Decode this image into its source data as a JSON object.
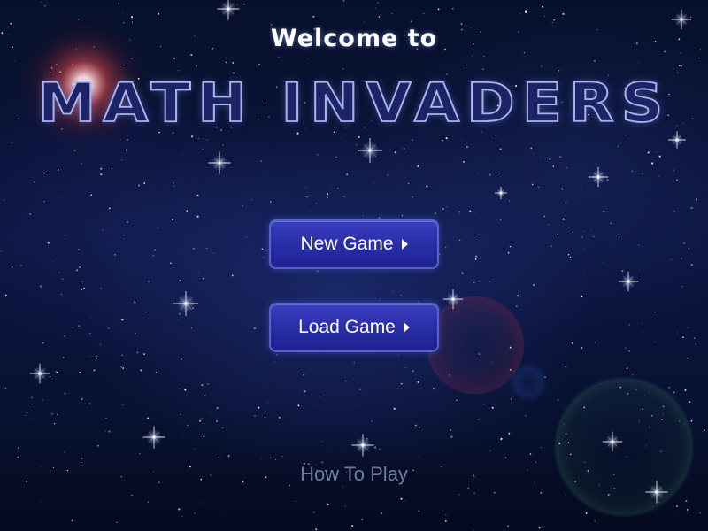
{
  "welcome_text": "Welcome to",
  "game_title": "MATH INVADERS",
  "menu": {
    "new_game_label": "New Game",
    "load_game_label": "Load Game",
    "how_to_play_label": "How To Play"
  },
  "colors": {
    "background": "#0b1640",
    "button_fill": "#2a2ea8",
    "button_border": "#5563c8",
    "title_outline": "#a7b3ef",
    "how_to_play_text": "#6f7aa0",
    "red_star": "#ff5a5a"
  }
}
